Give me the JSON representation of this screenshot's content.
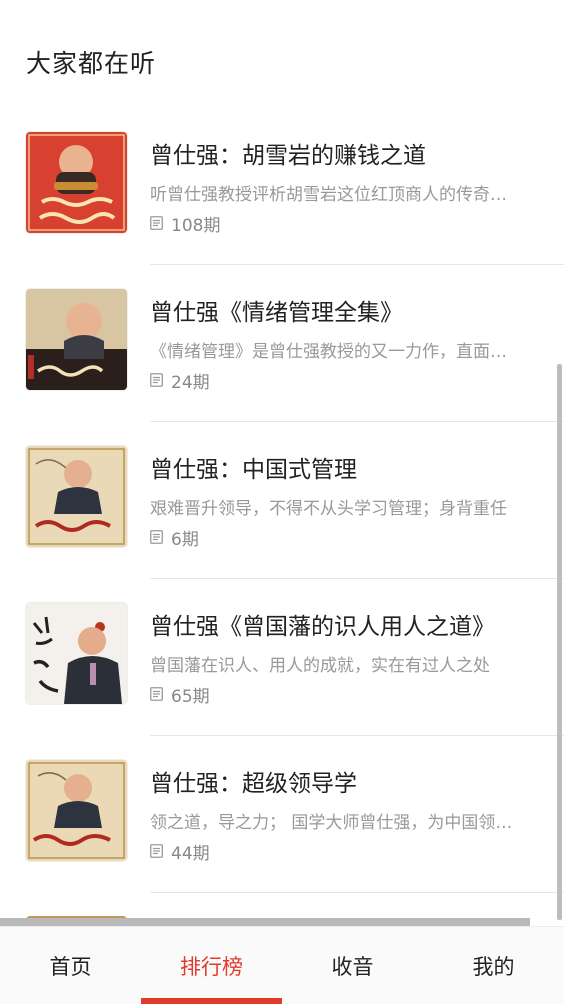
{
  "section": {
    "title": "大家都在听"
  },
  "items": [
    {
      "title": "曾仕强：胡雪岩的赚钱之道",
      "desc": "听曾仕强教授评析胡雪岩这位红顶商人的传奇一生",
      "count": "108期"
    },
    {
      "title": "曾仕强《情绪管理全集》",
      "desc": "《情绪管理》是曾仕强教授的又一力作，直面情绪",
      "count": "24期"
    },
    {
      "title": "曾仕强：中国式管理",
      "desc": "艰难晋升领导，不得不从头学习管理；身背重任",
      "count": "6期"
    },
    {
      "title": "曾仕强《曾国藩的识人用人之道》",
      "desc": "曾国藩在识人、用人的成就，实在有过人之处",
      "count": "65期"
    },
    {
      "title": "曾仕强：超级领导学",
      "desc": "领之道，导之力； 国学大师曾仕强，为中国领导者",
      "count": "44期"
    }
  ],
  "tabs": [
    {
      "label": "首页"
    },
    {
      "label": "排行榜"
    },
    {
      "label": "收音"
    },
    {
      "label": "我的"
    }
  ],
  "active_tab": "排行榜",
  "colors": {
    "accent": "#e23b2d",
    "text": "#222222",
    "secondary": "#999999"
  }
}
